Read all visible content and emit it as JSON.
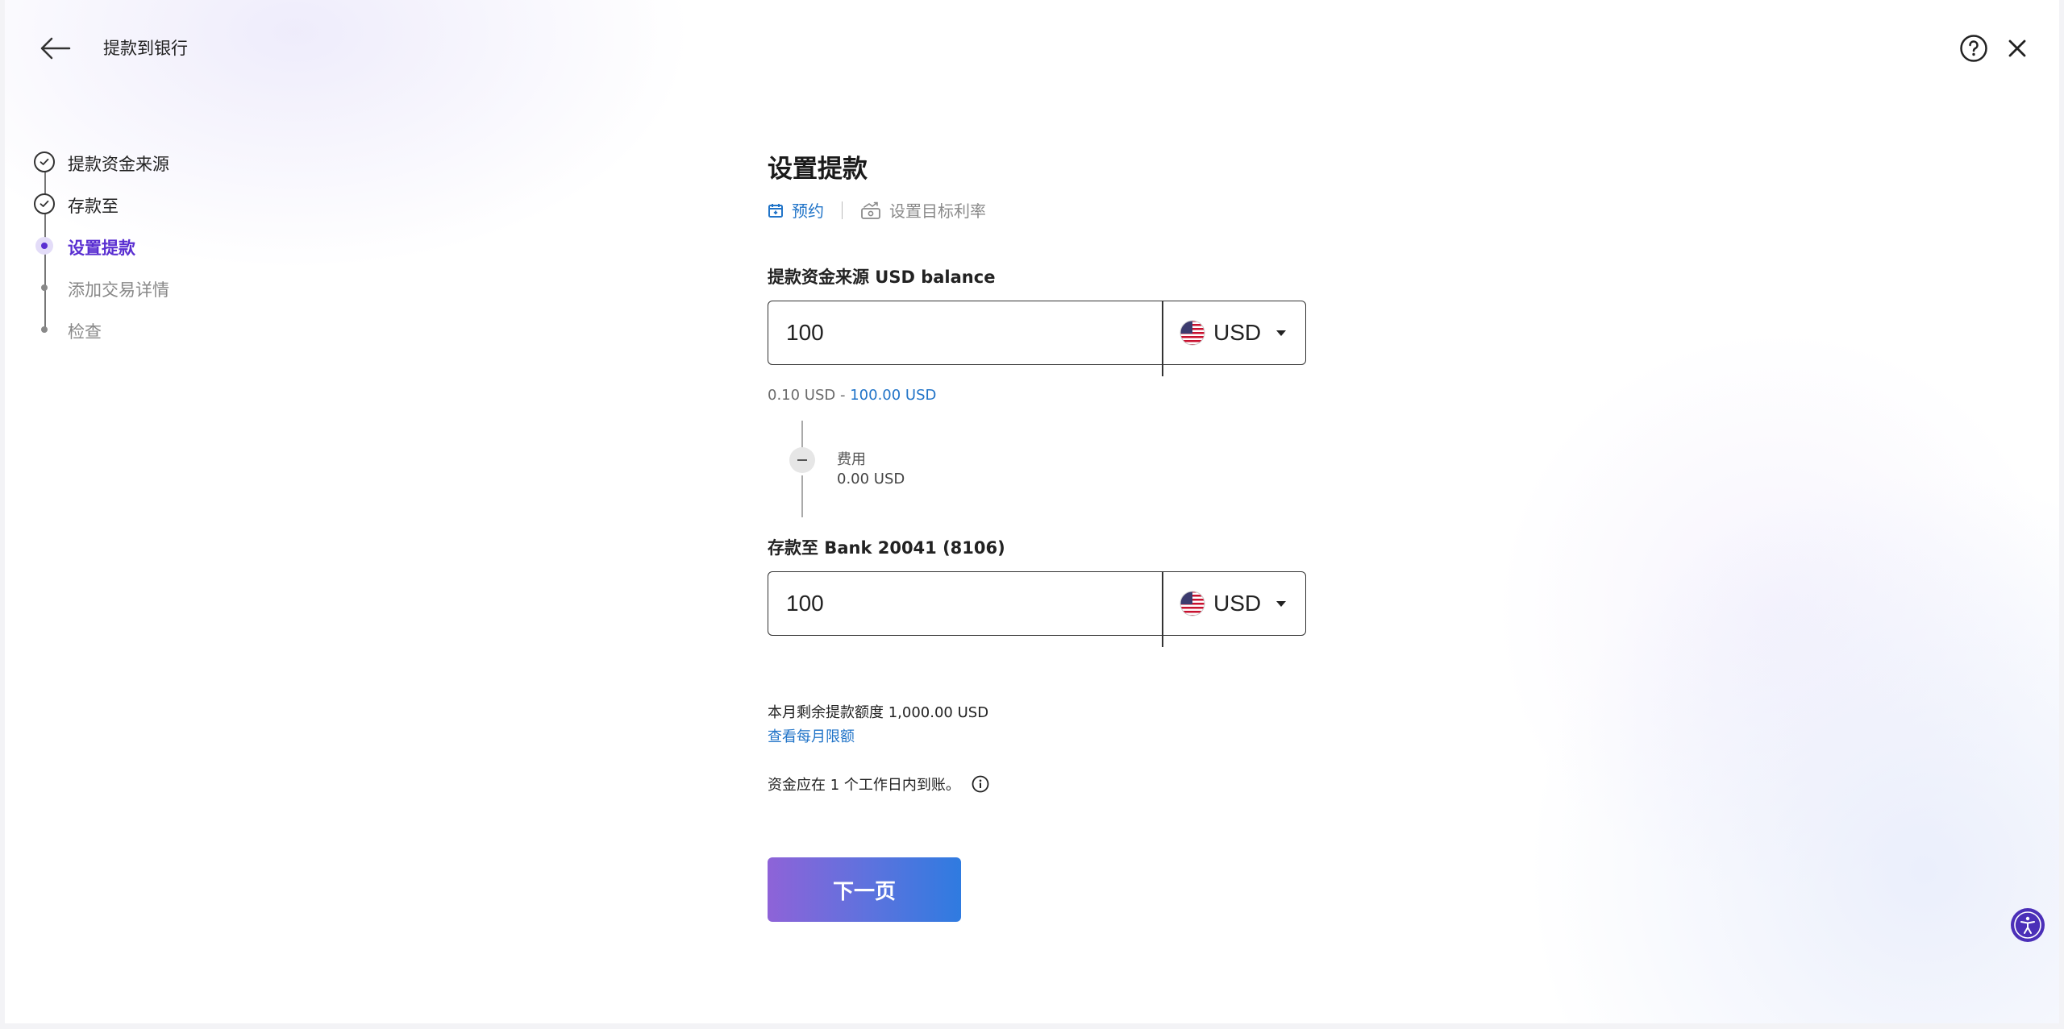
{
  "header": {
    "title": "提款到银行",
    "back_icon": "arrow-left-icon",
    "help_icon": "question-circle-icon",
    "close_icon": "close-icon"
  },
  "stepper": {
    "steps": [
      {
        "label": "提款资金来源",
        "state": "done"
      },
      {
        "label": "存款至",
        "state": "done"
      },
      {
        "label": "设置提款",
        "state": "active"
      },
      {
        "label": "添加交易详情",
        "state": "pending"
      },
      {
        "label": "检查",
        "state": "pending"
      }
    ]
  },
  "main": {
    "title": "设置提款",
    "tabs": [
      {
        "label": "预约",
        "icon": "calendar-icon",
        "active": true
      },
      {
        "label": "设置目标利率",
        "icon": "target-rate-icon",
        "active": false
      }
    ],
    "source": {
      "label": "提款资金来源 USD balance",
      "amount": "100",
      "currency": "USD",
      "range_min": "0.10 USD",
      "range_sep": " - ",
      "range_max": "100.00 USD"
    },
    "fee": {
      "label": "费用",
      "value": "0.00 USD"
    },
    "destination": {
      "label": "存款至 Bank 20041 (8106)",
      "amount": "100",
      "currency": "USD"
    },
    "limit": {
      "text": "本月剩余提款额度 1,000.00 USD",
      "link": "查看每月限额"
    },
    "arrival": {
      "text": "资金应在 1 个工作日内到账。"
    },
    "next_button": "下一页"
  },
  "colors": {
    "accent_blue": "#2174c8",
    "active_purple": "#5a2fd1"
  }
}
